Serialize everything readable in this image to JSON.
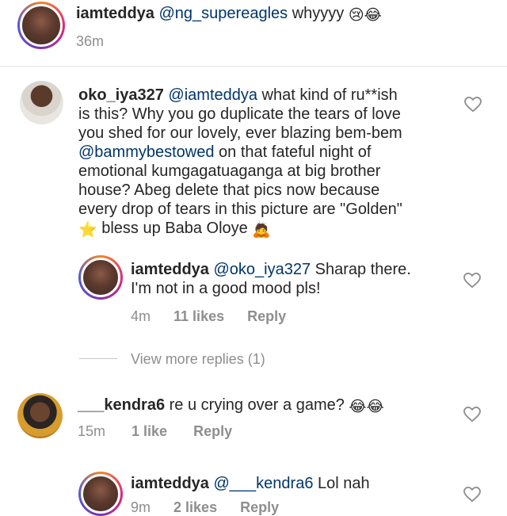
{
  "comments": [
    {
      "username": "iamteddya",
      "mention": "@ng_supereagles",
      "text": " whyyyy ",
      "emoji": "😢😂",
      "time": "36m"
    },
    {
      "username": "oko_iya327",
      "mention": "@iamteddya",
      "line1_text": " what kind of ru**ish",
      "line2": "is this? Why you go duplicate the tears of love",
      "line3": "you shed for our lovely, ever blazing bem-bem",
      "line4_mention": "@bammybestowed",
      "line4_text": " on that fateful night of",
      "line5": "emotional kumgagatuaganga at big brother",
      "line6": "house? Abeg delete that pics now because",
      "line7": "every drop of tears in this picture are \"Golden\"",
      "line8_star": "⭐",
      "line8_text": " bless up Baba Oloye ",
      "line8_emoji": "🙇"
    }
  ],
  "reply1": {
    "username": "iamteddya",
    "mention": "@oko_iya327",
    "text": " Sharap there.",
    "line2": "I'm not in a good mood pls!",
    "time": "4m",
    "likes": "11 likes",
    "reply": "Reply"
  },
  "view_more": "View more replies (1)",
  "comment3": {
    "username": "___kendra6",
    "text": " re u crying over a game? ",
    "emoji": "😂😂",
    "time": "15m",
    "likes": "1 like",
    "reply": "Reply"
  },
  "reply2": {
    "username": "iamteddya",
    "mention": "@___kendra6",
    "text": " Lol nah",
    "time": "9m",
    "likes": "2 likes",
    "reply": "Reply"
  },
  "colors": {
    "mention": "#003569",
    "meta": "#8e8e8e"
  },
  "icons": {
    "like": "heart-outline-icon"
  }
}
